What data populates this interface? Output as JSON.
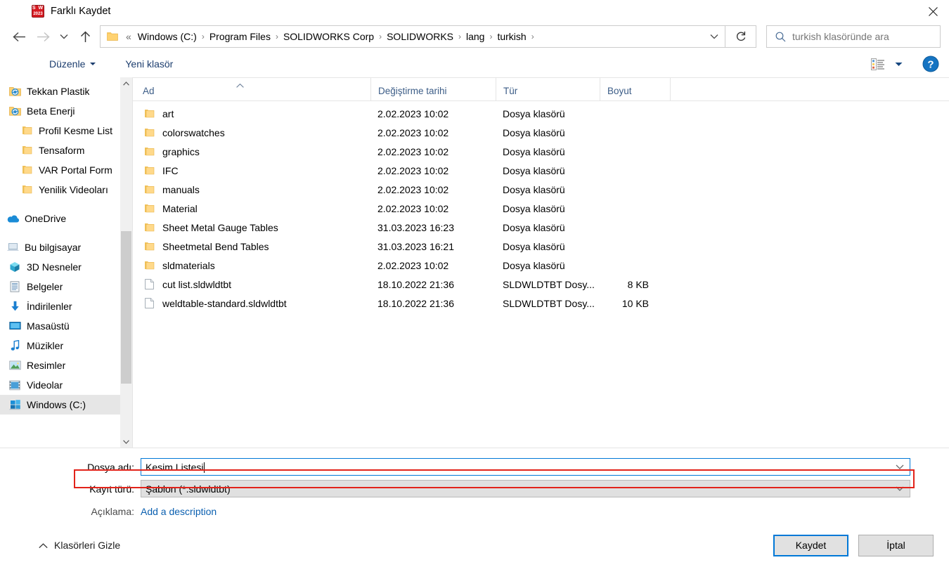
{
  "window": {
    "title": "Farklı Kaydet",
    "app_icon": "solidworks-icon",
    "app_icon_text": "S W",
    "app_icon_year": "2023",
    "close_label": "close-icon"
  },
  "nav": {
    "back": "back-arrow-icon",
    "forward": "forward-arrow-icon",
    "recent": "recent-locations-chevron-icon",
    "up": "up-arrow-icon",
    "refresh": "refresh-icon",
    "address_dropdown": "address-chevron-icon",
    "breadcrumb_prefix": "«",
    "breadcrumbs": [
      "Windows (C:)",
      "Program Files",
      "SOLIDWORKS Corp",
      "SOLIDWORKS",
      "lang",
      "turkish"
    ]
  },
  "search": {
    "placeholder": "turkish klasöründe ara",
    "value": "",
    "icon": "search-icon"
  },
  "toolbar": {
    "organize_label": "Düzenle",
    "new_folder_label": "Yeni klasör",
    "view_icon": "details-view-icon",
    "view_caret": "chevron-down-icon",
    "help_icon": "help-icon"
  },
  "sidebar": {
    "items": [
      {
        "label": "Tekkan Plastik",
        "icon": "sync-folder-icon",
        "indent": 1,
        "pinned": true,
        "selected": false
      },
      {
        "label": "Beta Enerji",
        "icon": "sync-folder-icon",
        "indent": 1,
        "pinned": true,
        "selected": false
      },
      {
        "label": "Profil Kesme List",
        "icon": "folder-icon",
        "indent": 2,
        "pinned": false,
        "selected": false
      },
      {
        "label": "Tensaform",
        "icon": "folder-icon",
        "indent": 2,
        "pinned": false,
        "selected": false
      },
      {
        "label": "VAR Portal Form",
        "icon": "folder-icon",
        "indent": 2,
        "pinned": false,
        "selected": false
      },
      {
        "label": "Yenilik Videoları",
        "icon": "folder-icon",
        "indent": 2,
        "pinned": false,
        "selected": false
      },
      {
        "label": "",
        "icon": "gap",
        "indent": 0,
        "pinned": false,
        "selected": false
      },
      {
        "label": "OneDrive",
        "icon": "onedrive-icon",
        "indent": 0,
        "pinned": false,
        "selected": false
      },
      {
        "label": "",
        "icon": "gap",
        "indent": 0,
        "pinned": false,
        "selected": false
      },
      {
        "label": "Bu bilgisayar",
        "icon": "this-pc-icon",
        "indent": 0,
        "pinned": false,
        "selected": false
      },
      {
        "label": "3D Nesneler",
        "icon": "3d-objects-icon",
        "indent": 1,
        "pinned": false,
        "selected": false
      },
      {
        "label": "Belgeler",
        "icon": "documents-icon",
        "indent": 1,
        "pinned": false,
        "selected": false
      },
      {
        "label": "İndirilenler",
        "icon": "downloads-icon",
        "indent": 1,
        "pinned": false,
        "selected": false
      },
      {
        "label": "Masaüstü",
        "icon": "desktop-icon",
        "indent": 1,
        "pinned": false,
        "selected": false
      },
      {
        "label": "Müzikler",
        "icon": "music-icon",
        "indent": 1,
        "pinned": false,
        "selected": false
      },
      {
        "label": "Resimler",
        "icon": "pictures-icon",
        "indent": 1,
        "pinned": false,
        "selected": false
      },
      {
        "label": "Videolar",
        "icon": "videos-icon",
        "indent": 1,
        "pinned": false,
        "selected": false
      },
      {
        "label": "Windows (C:)",
        "icon": "drive-icon",
        "indent": 1,
        "pinned": false,
        "selected": true
      }
    ],
    "scroll_up": "scroll-up-icon",
    "scroll_down": "scroll-down-icon"
  },
  "filelist": {
    "columns": [
      "Ad",
      "Değiştirme tarihi",
      "Tür",
      "Boyut"
    ],
    "sort_column": "Ad",
    "sort_direction": "ascending",
    "rows": [
      {
        "name": "art",
        "date": "2.02.2023 10:02",
        "type": "Dosya klasörü",
        "size": "",
        "icon": "folder-icon"
      },
      {
        "name": "colorswatches",
        "date": "2.02.2023 10:02",
        "type": "Dosya klasörü",
        "size": "",
        "icon": "folder-icon"
      },
      {
        "name": "graphics",
        "date": "2.02.2023 10:02",
        "type": "Dosya klasörü",
        "size": "",
        "icon": "folder-icon"
      },
      {
        "name": "IFC",
        "date": "2.02.2023 10:02",
        "type": "Dosya klasörü",
        "size": "",
        "icon": "folder-icon"
      },
      {
        "name": "manuals",
        "date": "2.02.2023 10:02",
        "type": "Dosya klasörü",
        "size": "",
        "icon": "folder-icon"
      },
      {
        "name": "Material",
        "date": "2.02.2023 10:02",
        "type": "Dosya klasörü",
        "size": "",
        "icon": "folder-icon"
      },
      {
        "name": "Sheet Metal Gauge Tables",
        "date": "31.03.2023 16:23",
        "type": "Dosya klasörü",
        "size": "",
        "icon": "folder-icon"
      },
      {
        "name": "Sheetmetal Bend Tables",
        "date": "31.03.2023 16:21",
        "type": "Dosya klasörü",
        "size": "",
        "icon": "folder-icon"
      },
      {
        "name": "sldmaterials",
        "date": "2.02.2023 10:02",
        "type": "Dosya klasörü",
        "size": "",
        "icon": "folder-icon"
      },
      {
        "name": "cut list.sldwldtbt",
        "date": "18.10.2022 21:36",
        "type": "SLDWLDTBT Dosy...",
        "size": "8 KB",
        "icon": "file-icon"
      },
      {
        "name": "weldtable-standard.sldwldtbt",
        "date": "18.10.2022 21:36",
        "type": "SLDWLDTBT Dosy...",
        "size": "10 KB",
        "icon": "file-icon"
      }
    ]
  },
  "form": {
    "filename_label": "Dosya adı:",
    "filename_value": "Kesim Listesi",
    "filetype_label": "Kayıt türü:",
    "filetype_value": "Şablon (*.sldwldtbt)",
    "description_label": "Açıklama:",
    "description_link": "Add a description",
    "highlight_color": "#e2231a",
    "focus_color": "#0078d7"
  },
  "footer": {
    "hide_folders_label": "Klasörleri Gizle",
    "hide_folders_icon": "chevron-up-icon",
    "save_label": "Kaydet",
    "cancel_label": "İptal"
  }
}
